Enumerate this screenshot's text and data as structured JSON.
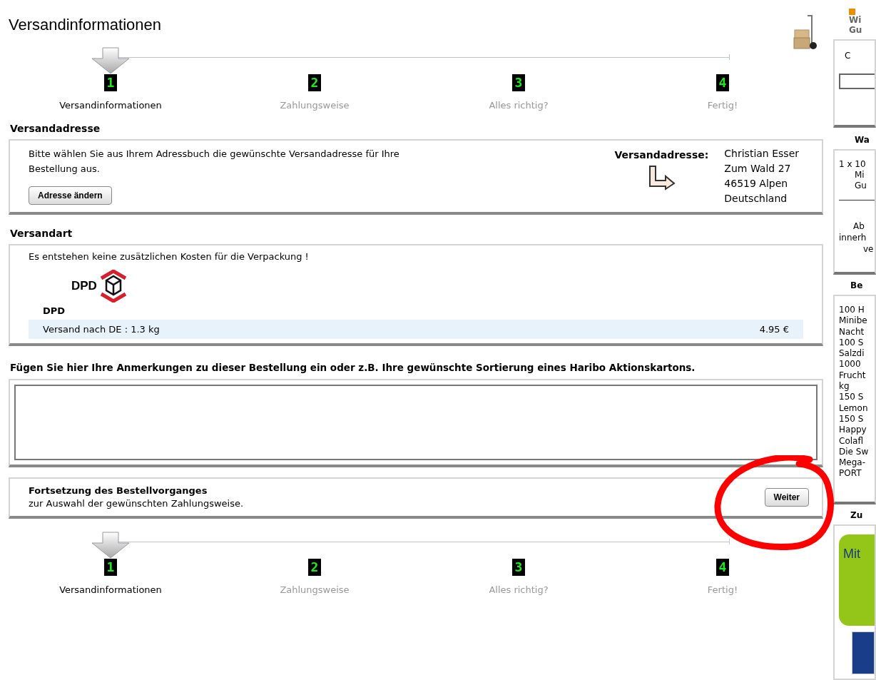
{
  "title": "Versandinformationen",
  "steps_top": [
    {
      "digit": "1",
      "label": "Versandinformationen",
      "selected": true
    },
    {
      "digit": "2",
      "label": "Zahlungsweise",
      "selected": false
    },
    {
      "digit": "3",
      "label": "Alles richtig?",
      "selected": false
    },
    {
      "digit": "4",
      "label": "Fertig!",
      "selected": false
    }
  ],
  "address_section": {
    "heading": "Versandadresse",
    "text": "Bitte wählen Sie aus Ihrem Adressbuch die gewünschte Versandadresse für Ihre Bestellung aus.",
    "button": "Adresse ändern",
    "label": "Versandadresse:",
    "lines": [
      "Christian Esser",
      "Zum Wald 27",
      "46519 Alpen",
      "Deutschland"
    ]
  },
  "shipping_section": {
    "heading": "Versandart",
    "note": "Es entstehen keine zusätzlichen Kosten für die Verpackung !",
    "carrier_logo": "DPD",
    "carrier": "DPD",
    "rate": {
      "label": "Versand nach DE : 1.3 kg",
      "price": "4.95 €"
    }
  },
  "comments_section": {
    "heading": "Fügen Sie hier Ihre Anmerkungen zu dieser Bestellung ein oder z.B. Ihre gewünschte Sortierung eines Haribo Aktionskartons."
  },
  "continue_section": {
    "title": "Fortsetzung des Bestellvorganges",
    "subtitle": "zur Auswahl der gewünschten Zahlungsweise.",
    "button": "Weiter"
  },
  "steps_bottom": [
    {
      "digit": "1",
      "label": "Versandinformationen",
      "selected": true
    },
    {
      "digit": "2",
      "label": "Zahlungsweise",
      "selected": false
    },
    {
      "digit": "3",
      "label": "Alles richtig?",
      "selected": false
    },
    {
      "digit": "4",
      "label": "Fertig!",
      "selected": false
    }
  ],
  "sidebar": {
    "top_lines": [
      "Wi",
      "Gu"
    ],
    "box1_text": "C",
    "cart_heading": "Wa",
    "cart_lines": [
      "1 x 10",
      "Mi",
      "Gu"
    ],
    "cart_note_lines": [
      "Ab",
      "innerh",
      "ve"
    ],
    "order_heading": "Be",
    "order_lines": [
      "100 H",
      "Minibe",
      "Nacht",
      "100 S",
      "Salzdi",
      "1000",
      "Frucht",
      "kg",
      "150 S",
      "Lemon",
      "150 S",
      "Happy",
      "Colafl",
      "Die Sw",
      "Mega-",
      "PORT"
    ],
    "payment_heading": "Zu",
    "payment_banner": "Mit"
  }
}
